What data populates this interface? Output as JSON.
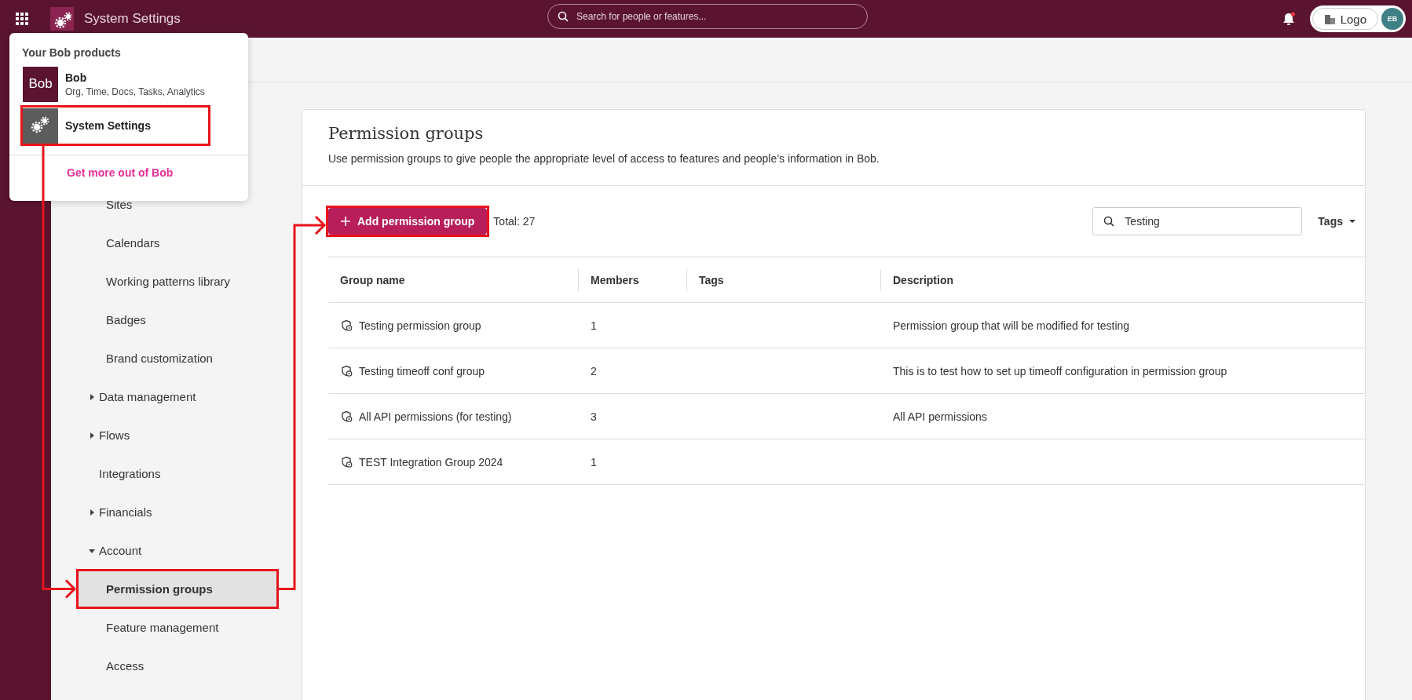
{
  "top_bar": {
    "app_title": "System Settings",
    "search": {
      "placeholder": "Search for people or features..."
    },
    "notifications": {
      "unread": true
    },
    "company": {
      "label": "Logo"
    },
    "avatar": {
      "initials": "EB"
    }
  },
  "products_menu": {
    "title": "Your Bob products",
    "items": [
      {
        "kind": "bob",
        "logo_text": "Bob",
        "name": "Bob",
        "subtitle": "Org, Time, Docs, Tasks, Analytics"
      },
      {
        "kind": "settings",
        "name": "System Settings",
        "annotated": true
      }
    ],
    "footer_link": "Get more out of Bob"
  },
  "sidebar": {
    "items": [
      {
        "children": [
          {
            "label": "Sites",
            "selected": false
          },
          {
            "label": "Calendars",
            "selected": false
          },
          {
            "label": "Working patterns library",
            "selected": false
          },
          {
            "label": "Badges",
            "selected": false
          },
          {
            "label": "Brand customization",
            "selected": false
          }
        ]
      },
      {
        "label": "Data management",
        "expanded": false,
        "selected": false
      },
      {
        "label": "Flows",
        "expanded": false,
        "selected": false
      },
      {
        "label": "Integrations",
        "selected": false
      },
      {
        "label": "Financials",
        "expanded": false,
        "selected": false
      },
      {
        "label": "Account",
        "expanded": true,
        "selected": false,
        "children": [
          {
            "label": "Permission groups",
            "selected": true,
            "annotated": true
          },
          {
            "label": "Feature management",
            "selected": false
          },
          {
            "label": "Access",
            "selected": false
          }
        ]
      }
    ]
  },
  "page": {
    "title": "Permission groups",
    "description": "Use permission groups to give people the appropriate level of access to features and people’s information in Bob.",
    "add_button": {
      "label": "Add permission group",
      "annotated": true
    },
    "total": "Total: 27",
    "search": {
      "value": "Testing"
    },
    "tags_filter": "Tags"
  },
  "table": {
    "columns": [
      "Group name",
      "Members",
      "Tags",
      "Description"
    ],
    "rows": [
      {
        "cells": [
          "Testing permission group",
          "1",
          "",
          "Permission group that will be modified for testing"
        ]
      },
      {
        "cells": [
          "Testing timeoff conf group",
          "2",
          "",
          "This is to test how to set up timeoff configuration in permission group"
        ]
      },
      {
        "cells": [
          "All API permissions (for testing)",
          "3",
          "",
          "All API permissions"
        ]
      },
      {
        "cells": [
          "TEST Integration Group 2024",
          "1",
          "",
          ""
        ]
      }
    ]
  }
}
